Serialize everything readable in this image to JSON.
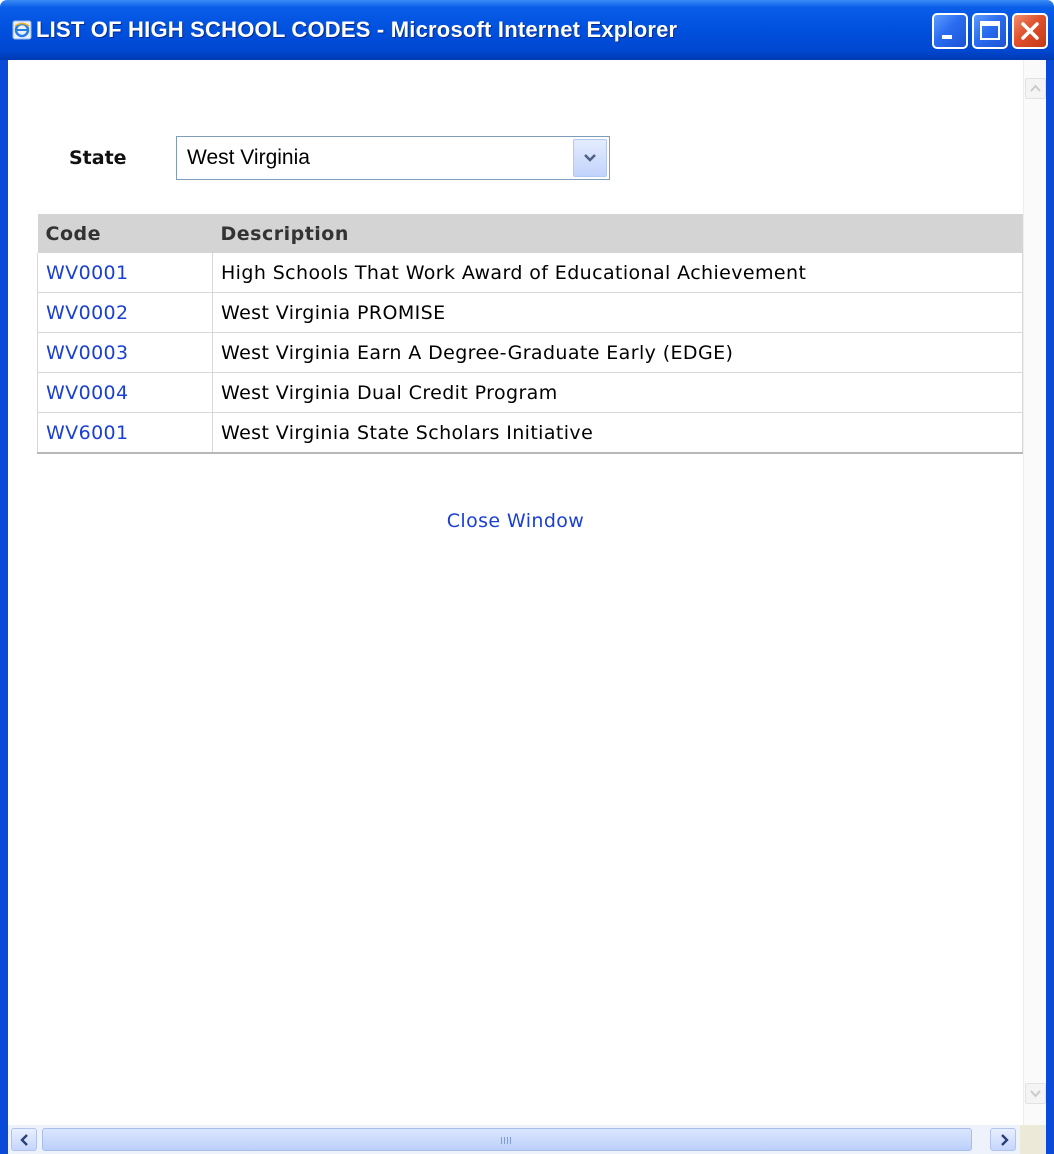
{
  "window": {
    "title": "LIST OF HIGH SCHOOL CODES - Microsoft Internet Explorer",
    "title_bar_color": "#0050de",
    "close_button_color": "#e0502c"
  },
  "form": {
    "state_label": "State",
    "state_selected": "West Virginia"
  },
  "table": {
    "headers": {
      "code": "Code",
      "description": "Description"
    },
    "rows": [
      {
        "code": "WV0001",
        "description": "High Schools That Work Award of Educational Achievement"
      },
      {
        "code": "WV0002",
        "description": "West Virginia PROMISE"
      },
      {
        "code": "WV0003",
        "description": "West Virginia Earn A Degree-Graduate Early (EDGE)"
      },
      {
        "code": "WV0004",
        "description": "West Virginia Dual Credit Program"
      },
      {
        "code": "WV6001",
        "description": "West Virginia State Scholars Initiative"
      }
    ],
    "link_color": "#1a3fd4",
    "header_bg": "#d4d4d4"
  },
  "footer": {
    "close_label": "Close Window"
  },
  "icons": {
    "title": "ie-icon",
    "minimize": "minimize-icon",
    "maximize": "maximize-icon",
    "close": "close-icon",
    "dropdown": "chevron-down-icon"
  }
}
